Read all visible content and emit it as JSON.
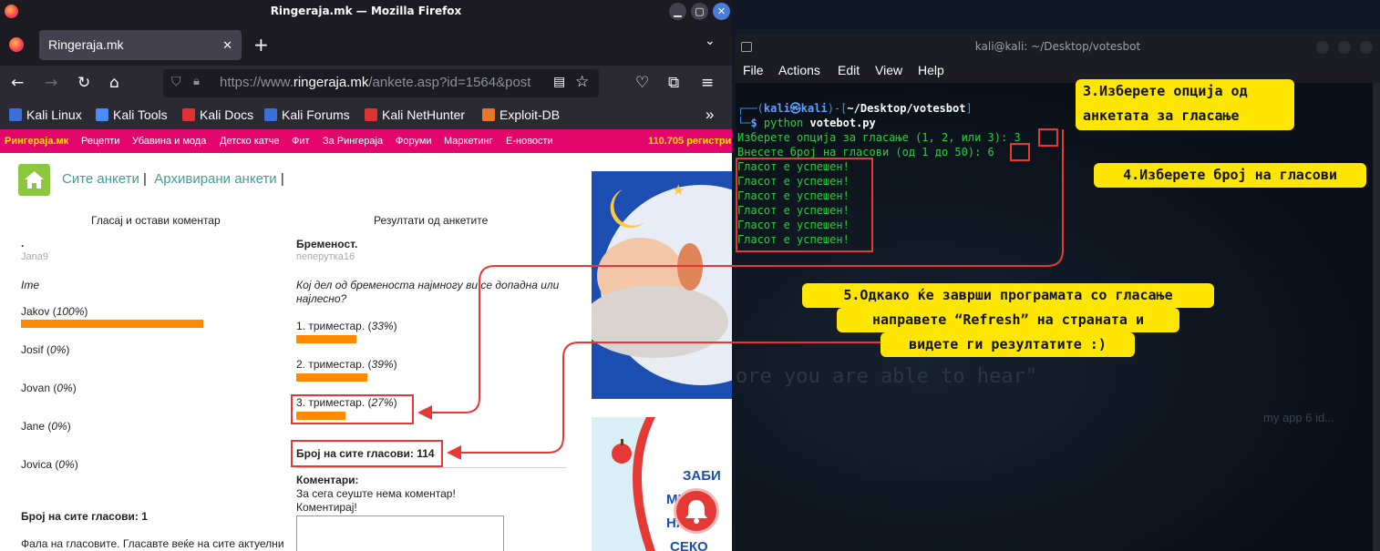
{
  "browser": {
    "window_title": "Ringeraja.mk — Mozilla Firefox",
    "tab_title": "Ringeraja.mk",
    "url_prefix": "https://www.",
    "url_domain": "ringeraja.mk",
    "url_path": "/ankete.asp?id=1564&post",
    "bookmarks": [
      "Kali Linux",
      "Kali Tools",
      "Kali Docs",
      "Kali Forums",
      "Kali NetHunter",
      "Exploit-DB"
    ]
  },
  "site": {
    "nav": [
      "Рингераја.мк",
      "Рецепти",
      "Убавина и мода",
      "Детско катче",
      "Фит",
      "За Рингераја",
      "Форуми",
      "Маркетинг",
      "Е-новости"
    ],
    "nav_right": "110.705 регистри",
    "top_links": {
      "all": "Сите анкети",
      "archived": "Архивирани анкети",
      "sep": "|"
    },
    "left": {
      "heading": "Гласај и остави коментар",
      "dot": ".",
      "user": "Jana9",
      "question": "Ime",
      "options": [
        {
          "name": "Jakov",
          "pct": "100%",
          "value": 100
        },
        {
          "name": "Josif",
          "pct": "0%",
          "value": 0
        },
        {
          "name": "Jovan",
          "pct": "0%",
          "value": 0
        },
        {
          "name": "Jane",
          "pct": "0%",
          "value": 0
        },
        {
          "name": "Jovica",
          "pct": "0%",
          "value": 0
        }
      ],
      "total": "Број на сите гласови: 1",
      "footer_text": "Фала на гласовите. Гласавте веќе на сите актуелни"
    },
    "right": {
      "heading": "Резултати од анкетите",
      "title": "Бременост.",
      "user": "пеперутка16",
      "question_l1": "Кој дел од бременоста најмногу ви се допадна или",
      "question_l2": "најлесно?",
      "options": [
        {
          "name": "1. триместар.",
          "pct": "33%",
          "value": 33
        },
        {
          "name": "2. триместар.",
          "pct": "39%",
          "value": 39
        },
        {
          "name": "3. триместар.",
          "pct": "27%",
          "value": 27
        }
      ],
      "total": "Број на сите гласови: 114",
      "comments_label": "Коментари:",
      "no_comments": "За сега сеуште нема коментар!",
      "comment_prompt": "Коментирај!"
    },
    "ad2_text": [
      "ЗАБИ",
      "МЕЧТ",
      "НАВ",
      "СЕКО"
    ]
  },
  "terminal": {
    "title": "kali@kali: ~/Desktop/votesbot",
    "menu": [
      "File",
      "Actions",
      "Edit",
      "View",
      "Help"
    ],
    "prompt_user": "kali㉿kali",
    "prompt_path": "~/Desktop/votesbot",
    "command": "python",
    "script": "votebot.py",
    "line_option": "Изберете опција за гласање (1, 2, или 3): ",
    "option_value": "3",
    "line_count": "Внесете број на гласови (од 1 до 50): ",
    "count_value": "6",
    "success": [
      "Гласот е успешен!",
      "Гласот е успешен!",
      "Гласот е успешен!",
      "Гласот е успешен!",
      "Гласот е успешен!",
      "Гласот е успешен!"
    ],
    "bg_text": "ore you are able to hear\"",
    "bg_app": "my app 6 id..."
  },
  "callouts": {
    "c3_l1": "3.Изберете опција од",
    "c3_l2": "анкетата за гласање",
    "c4": "4.Изберете број на гласови",
    "c5_l1": "5.Одкако ќе заврши програмата со гласање",
    "c5_l2": "направете “Refresh” на страната и",
    "c5_l3": "видете ги резултатите :)"
  },
  "colors": {
    "accent": "#e3066d",
    "bar": "#ff8a00",
    "callout": "#ffe600",
    "highlight": "#e53935",
    "terminal_text": "#2ecc40"
  }
}
